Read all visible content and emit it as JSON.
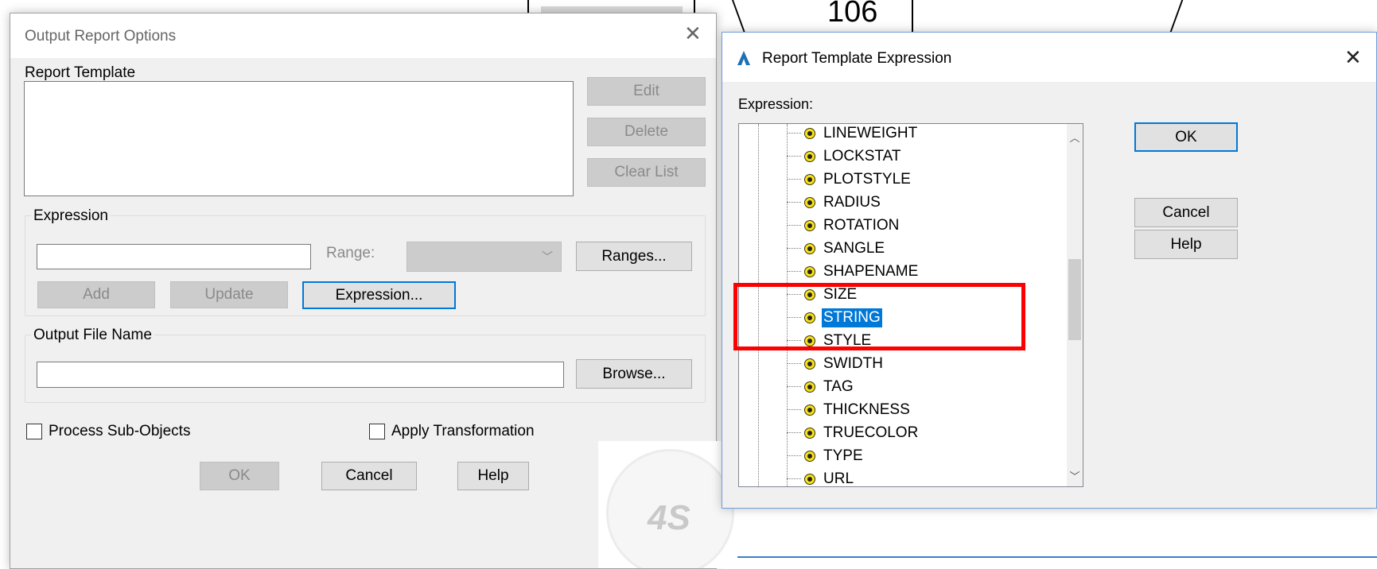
{
  "background": {
    "number_label": "106"
  },
  "output_report_dialog": {
    "title": "Output Report Options",
    "report_template_label": "Report Template",
    "edit_button": "Edit",
    "delete_button": "Delete",
    "clear_list_button": "Clear List",
    "expression_group": "Expression",
    "expression_value": "",
    "range_label": "Range:",
    "range_value": "",
    "ranges_button": "Ranges...",
    "add_button": "Add",
    "update_button": "Update",
    "expression_button": "Expression...",
    "output_file_group": "Output File Name",
    "output_file_value": "",
    "browse_button": "Browse...",
    "process_sub_objects": {
      "label": "Process Sub-Objects",
      "checked": false
    },
    "apply_transformation": {
      "label": "Apply Transformation",
      "checked": false
    },
    "ok_button": "OK",
    "cancel_button": "Cancel",
    "help_button": "Help"
  },
  "expression_dialog": {
    "title": "Report Template Expression",
    "expression_label": "Expression:",
    "ok_button": "OK",
    "cancel_button": "Cancel",
    "help_button": "Help",
    "tree_items": [
      {
        "label": "LINEWEIGHT"
      },
      {
        "label": "LOCKSTAT"
      },
      {
        "label": "PLOTSTYLE"
      },
      {
        "label": "RADIUS"
      },
      {
        "label": "ROTATION"
      },
      {
        "label": "SANGLE"
      },
      {
        "label": "SHAPENAME"
      },
      {
        "label": "SIZE"
      },
      {
        "label": "STRING",
        "selected": true
      },
      {
        "label": "STYLE"
      },
      {
        "label": "SWIDTH"
      },
      {
        "label": "TAG"
      },
      {
        "label": "THICKNESS"
      },
      {
        "label": "TRUECOLOR"
      },
      {
        "label": "TYPE"
      },
      {
        "label": "URL"
      }
    ]
  },
  "watermark": {
    "text": "4S"
  },
  "colors": {
    "dialog_bg": "#f0f0f0",
    "selection": "#0078d7",
    "highlight_box": "#ff0000"
  }
}
